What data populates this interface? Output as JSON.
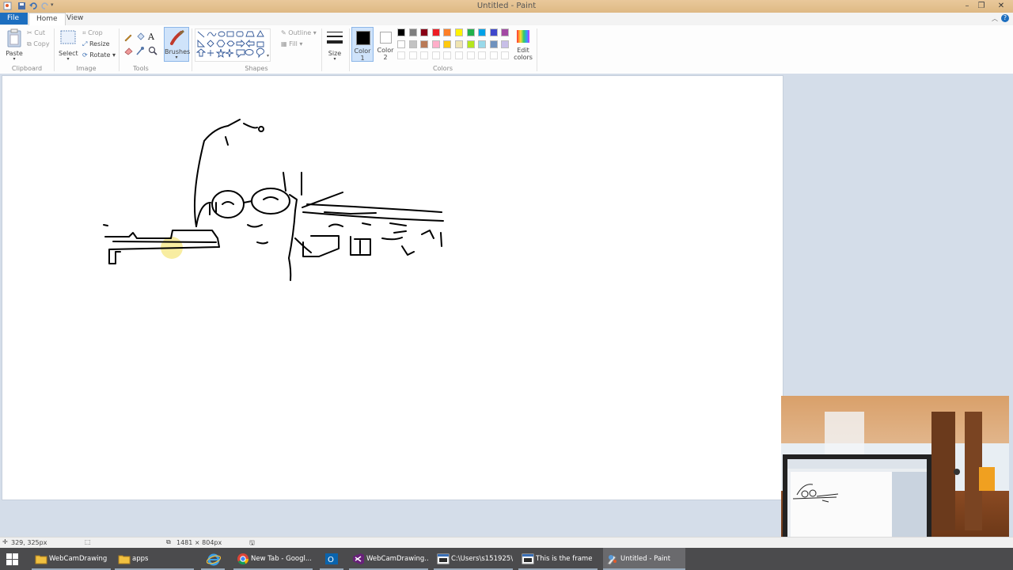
{
  "window": {
    "title": "Untitled - Paint"
  },
  "tabs": {
    "file": "File",
    "home": "Home",
    "view": "View"
  },
  "clipboard": {
    "paste": "Paste",
    "cut": "Cut",
    "copy": "Copy",
    "group": "Clipboard"
  },
  "image": {
    "select": "Select",
    "crop": "Crop",
    "resize": "Resize",
    "rotate": "Rotate",
    "group": "Image"
  },
  "tools": {
    "group": "Tools",
    "brushes": "Brushes"
  },
  "shapes": {
    "outline": "Outline",
    "fill": "Fill",
    "group": "Shapes"
  },
  "size": {
    "label": "Size"
  },
  "colors": {
    "color1": "Color 1",
    "color2": "Color 2",
    "edit": "Edit colors",
    "group": "Colors",
    "color1_value": "#000000",
    "color2_value": "#ffffff",
    "palette_row1": [
      "#000000",
      "#7f7f7f",
      "#880015",
      "#ed1c24",
      "#ff7f27",
      "#fff200",
      "#22b14c",
      "#00a2e8",
      "#3f48cc",
      "#a349a4"
    ],
    "palette_row2": [
      "#ffffff",
      "#c3c3c3",
      "#b97a57",
      "#ffaec9",
      "#ffc90e",
      "#efe4b0",
      "#b5e61d",
      "#99d9ea",
      "#7092be",
      "#c8bfe7"
    ]
  },
  "status": {
    "cursor_pos": "329, 325px",
    "canvas_size": "1481 × 804px"
  },
  "taskbar": {
    "items": [
      {
        "label": "WebCamDrawing",
        "icon": "folder-icon"
      },
      {
        "label": "apps",
        "icon": "folder-icon"
      },
      {
        "label": "",
        "icon": "internet-explorer-icon"
      },
      {
        "label": "New Tab - Googl...",
        "icon": "chrome-icon"
      },
      {
        "label": "",
        "icon": "outlook-icon"
      },
      {
        "label": "WebCamDrawing...",
        "icon": "visual-studio-icon"
      },
      {
        "label": "C:\\Users\\s151925\\...",
        "icon": "console-window-icon"
      },
      {
        "label": "This is the frame",
        "icon": "console-window-icon"
      },
      {
        "label": "Untitled - Paint",
        "icon": "paint-icon"
      }
    ]
  },
  "accent": "#1c6ebf"
}
